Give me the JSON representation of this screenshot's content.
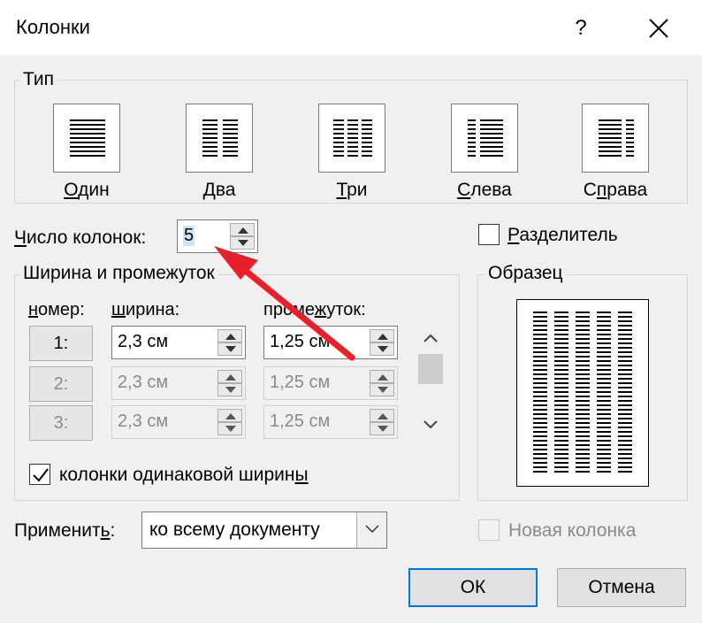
{
  "window": {
    "title": "Колонки",
    "help_label": "?"
  },
  "type_group": {
    "label": "Тип",
    "presets": [
      {
        "key": "one",
        "label": "Один",
        "mnemonic": "О",
        "rest": "дин"
      },
      {
        "key": "two",
        "label": "Два",
        "mnemonic": "Д",
        "rest": "ва"
      },
      {
        "key": "three",
        "label": "Три",
        "mnemonic": "Т",
        "rest": "ри"
      },
      {
        "key": "left",
        "label": "Слева",
        "mnemonic": "С",
        "rest": "лева"
      },
      {
        "key": "right",
        "label": "Справа",
        "pre": "С",
        "mnemonic": "п",
        "rest": "рава"
      }
    ]
  },
  "num_columns": {
    "label_mnemonic": "Ч",
    "label_rest": "исло колонок:",
    "value": "5"
  },
  "separator": {
    "label_mnemonic": "Р",
    "label_rest": "азделитель",
    "checked": false
  },
  "width_group": {
    "label": "Ширина и промежуток",
    "col_header": {
      "pre": "",
      "mnemonic": "н",
      "rest": "омер:"
    },
    "width_header": {
      "pre": "",
      "mnemonic": "ш",
      "rest": "ирина:"
    },
    "spacing_header": {
      "pre": "проме",
      "mnemonic": "ж",
      "rest": "уток:"
    },
    "rows": [
      {
        "num": "1:",
        "width": "2,3 см",
        "spacing": "1,25 см",
        "enabled": true
      },
      {
        "num": "2:",
        "width": "2,3 см",
        "spacing": "1,25 см",
        "enabled": false
      },
      {
        "num": "3:",
        "width": "2,3 см",
        "spacing": "1,25 см",
        "enabled": false
      }
    ],
    "equal_width": {
      "label_pre": "колонки одинаковой ширин",
      "label_mnemonic": "ы",
      "checked": true
    }
  },
  "sample": {
    "label": "Образец",
    "columns": 5
  },
  "apply": {
    "label_pre": "Применит",
    "label_mnemonic": "ь",
    "label_post": ":",
    "value": "ко всему документу"
  },
  "new_column": {
    "label": "Новая колонка",
    "checked": false,
    "enabled": false
  },
  "buttons": {
    "ok": "ОК",
    "cancel": "Отмена"
  },
  "colors": {
    "dialog_bg": "#f0f0f0",
    "accent": "#0078d7",
    "annotation_arrow": "#e8202a",
    "disabled_text": "#8a8a8a"
  }
}
